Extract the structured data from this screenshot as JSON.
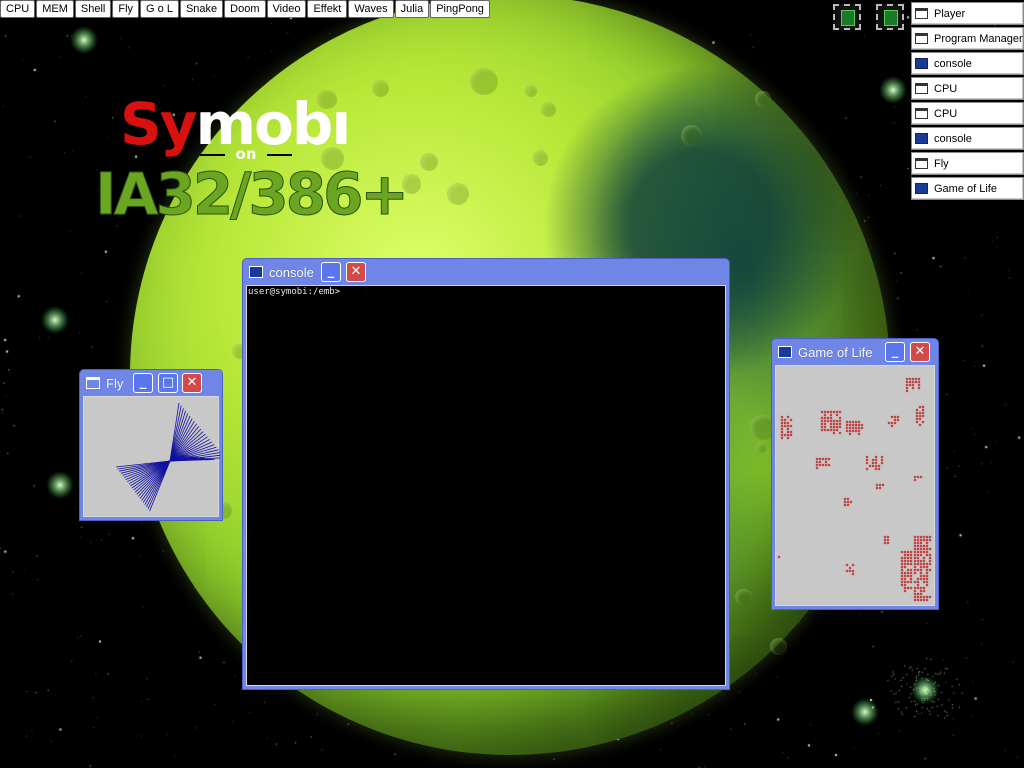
{
  "taskbar": {
    "buttons": [
      "CPU",
      "MEM",
      "Shell",
      "Fly",
      "G o L",
      "Snake",
      "Doom",
      "Video",
      "Effekt",
      "Waves",
      "Julia",
      "PingPong"
    ]
  },
  "window_list": {
    "items": [
      {
        "label": "Player",
        "icon": "window-icon"
      },
      {
        "label": "Program Manager",
        "icon": "window-icon"
      },
      {
        "label": "console",
        "icon": "console-icon"
      },
      {
        "label": "CPU",
        "icon": "window-icon"
      },
      {
        "label": "CPU",
        "icon": "window-icon"
      },
      {
        "label": "console",
        "icon": "console-icon"
      },
      {
        "label": "Fly",
        "icon": "window-icon"
      },
      {
        "label": "Game of Life",
        "icon": "console-icon"
      }
    ]
  },
  "logo": {
    "part1": "Sy",
    "part2": "mobı",
    "on": "on",
    "arch": "IA32/386+"
  },
  "console_window": {
    "title": "console",
    "prompt": "user@symobi:/emb>"
  },
  "fly_window": {
    "title": "Fly"
  },
  "gol_window": {
    "title": "Game of Life"
  },
  "colors": {
    "title_bar": "#6f86e6",
    "close_button": "#d24a4a",
    "logo_red": "#d81010",
    "logo_green": "#6aa621",
    "cell": "#c01818"
  }
}
